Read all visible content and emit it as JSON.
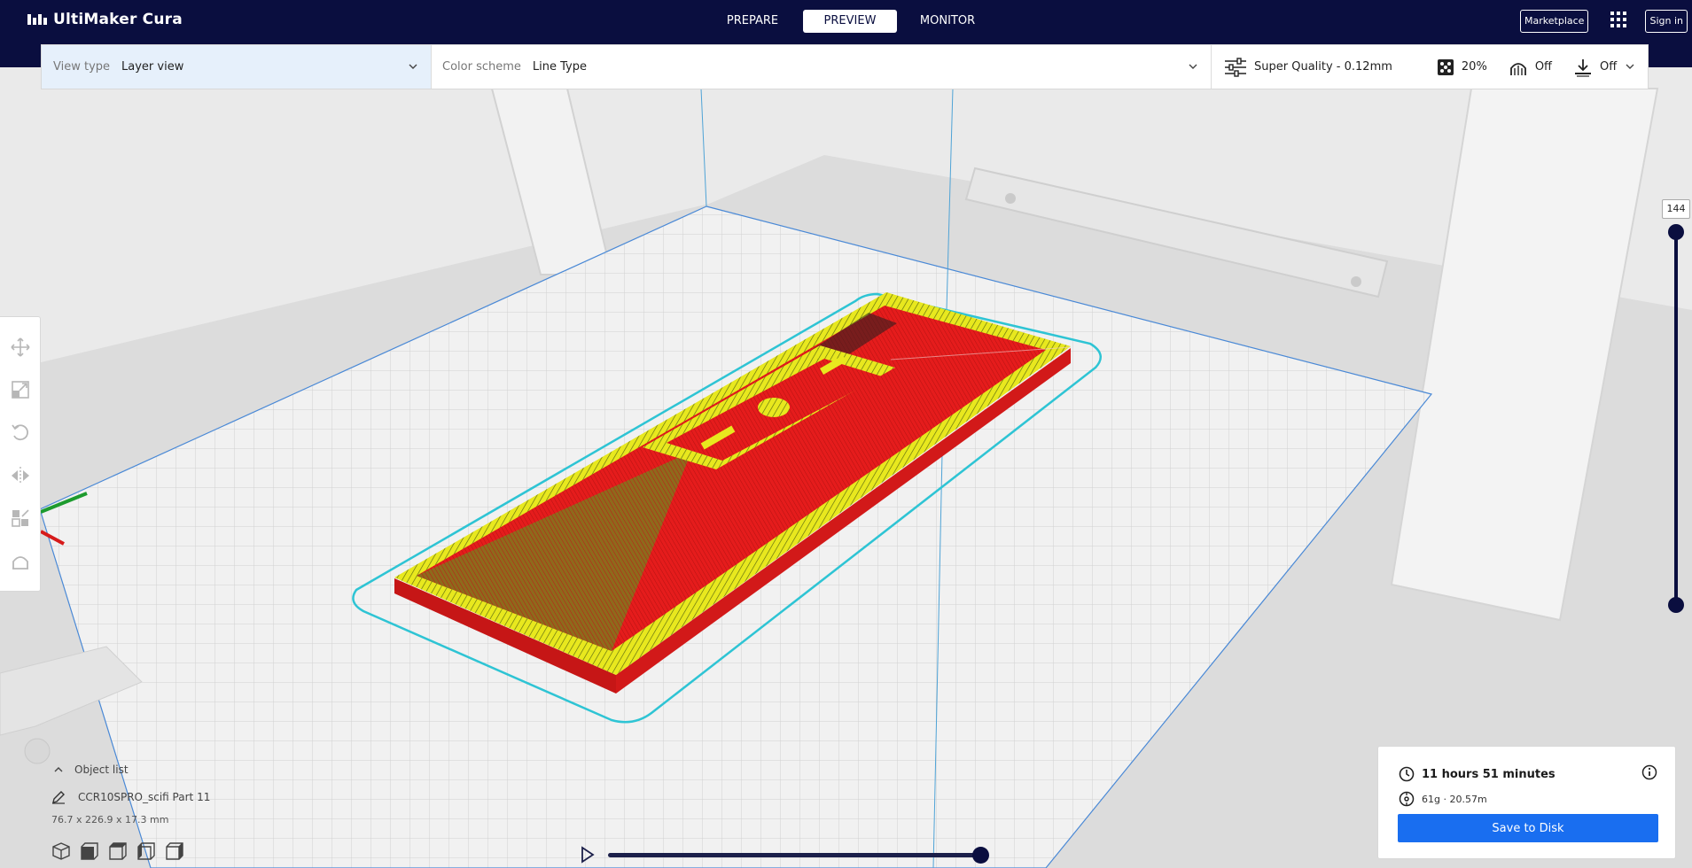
{
  "app": {
    "name": "UltiMaker Cura"
  },
  "header": {
    "tabs": [
      {
        "label": "PREPARE",
        "active": false
      },
      {
        "label": "PREVIEW",
        "active": true
      },
      {
        "label": "MONITOR",
        "active": false
      }
    ],
    "marketplace_label": "Marketplace",
    "sign_in_label": "Sign in"
  },
  "stagebar": {
    "view_type_label": "View type",
    "view_type_value": "Layer view",
    "color_scheme_label": "Color scheme",
    "color_scheme_value": "Line Type",
    "quality": "Super Quality - 0.12mm",
    "infill": "20%",
    "support": "Off",
    "adhesion": "Off"
  },
  "layer_slider": {
    "current_layer": "144"
  },
  "object_list": {
    "toggle_label": "Object list",
    "object_name": "CCR10SPRO_scifi Part 11",
    "dimensions": "76.7 x 226.9 x 17.3 mm"
  },
  "job": {
    "print_time": "11 hours 51 minutes",
    "material": "61g · 20.57m",
    "save_label": "Save to Disk"
  },
  "colors": {
    "header_bg": "#0a0e3f",
    "accent_blue": "#196ef0",
    "model_red": "#e51c1c",
    "model_yellow": "#e8e81e",
    "skirt_cyan": "#2ec4d4"
  }
}
